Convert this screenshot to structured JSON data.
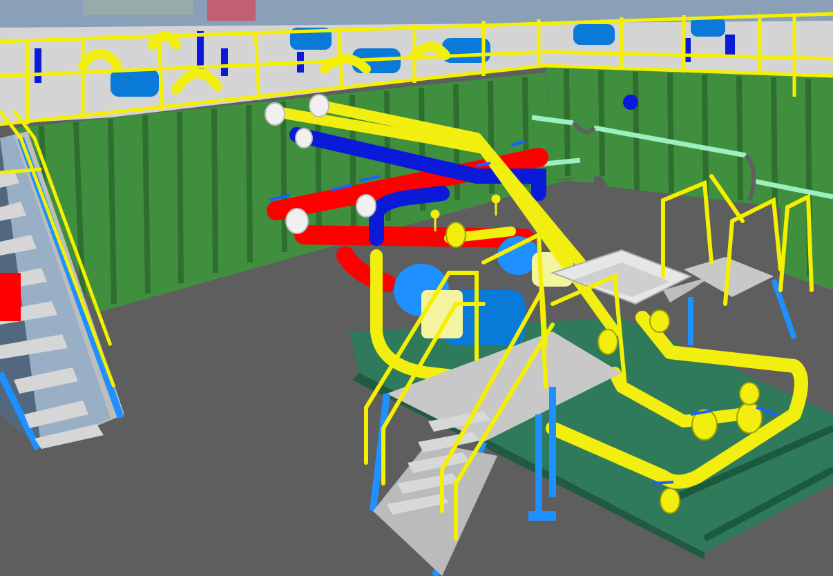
{
  "viewport": {
    "type": "3d-plant-model",
    "colors": {
      "floor": "#5e5e5e",
      "container_wall": "#3f8f3f",
      "container_rib": "#2e6e2e",
      "deck": "#d4d4d4",
      "railing": "#f4f000",
      "pipe_yellow": "#f2ee10",
      "pipe_red": "#ff0000",
      "pipe_blue": "#0a1ad8",
      "pipe_mint": "#9cf0c0",
      "steel_blue": "#1e90ff",
      "motor_blue": "#0a7ad8",
      "skid_green": "#2f7a5a",
      "hopper": "#e6e6e6",
      "valve_handle": "#1a60ff",
      "flange_white": "#f0f0f0"
    },
    "icons": [
      "pump-motor-icon",
      "valve-icon",
      "hopper-icon",
      "stair-icon"
    ]
  }
}
